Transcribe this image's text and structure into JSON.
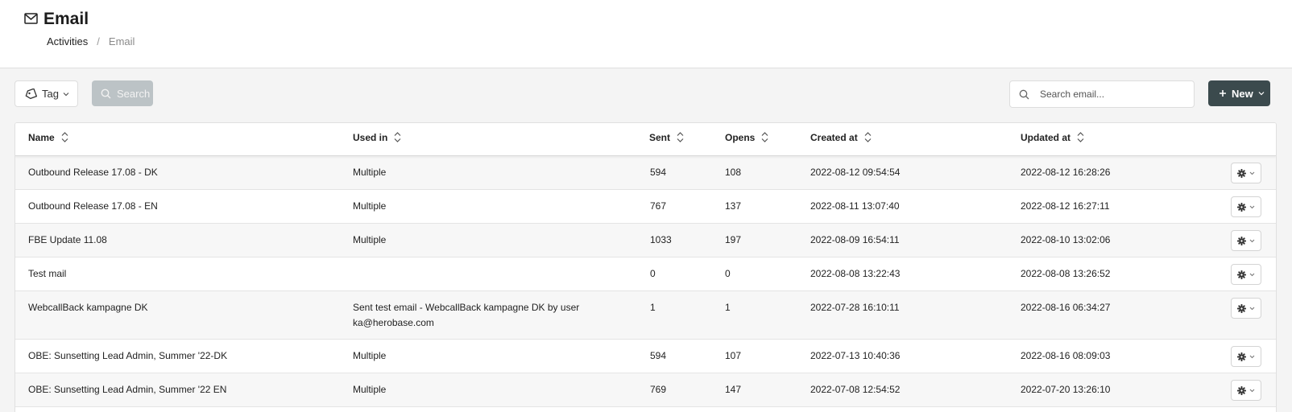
{
  "header": {
    "title": "Email",
    "icon": "mail-icon",
    "breadcrumb": {
      "parent": "Activities",
      "separator": "/",
      "current": "Email"
    }
  },
  "toolbar": {
    "tag_label": "Tag",
    "search_button_label": "Search",
    "search_placeholder": "Search email...",
    "new_label": "New"
  },
  "colors": {
    "primary_button": "#3b4a4d",
    "disabled_button": "#bcc3c6",
    "row_alt": "#f7f7f7"
  },
  "table": {
    "columns": [
      {
        "label": "Name"
      },
      {
        "label": "Used in"
      },
      {
        "label": "Sent"
      },
      {
        "label": "Opens"
      },
      {
        "label": "Created at"
      },
      {
        "label": "Updated at"
      }
    ],
    "rows": [
      {
        "name": "Outbound Release 17.08 - DK",
        "used_in": "Multiple",
        "sent": "594",
        "opens": "108",
        "created": "2022-08-12 09:54:54",
        "updated": "2022-08-12 16:28:26"
      },
      {
        "name": "Outbound Release 17.08 - EN",
        "used_in": "Multiple",
        "sent": "767",
        "opens": "137",
        "created": "2022-08-11 13:07:40",
        "updated": "2022-08-12 16:27:11"
      },
      {
        "name": "FBE Update 11.08",
        "used_in": "Multiple",
        "sent": "1033",
        "opens": "197",
        "created": "2022-08-09 16:54:11",
        "updated": "2022-08-10 13:02:06"
      },
      {
        "name": "Test mail",
        "used_in": "",
        "sent": "0",
        "opens": "0",
        "created": "2022-08-08 13:22:43",
        "updated": "2022-08-08 13:26:52"
      },
      {
        "name": "WebcallBack kampagne DK",
        "used_in": "Sent test email - WebcallBack kampagne DK by user ka@herobase.com",
        "sent": "1",
        "opens": "1",
        "created": "2022-07-28 16:10:11",
        "updated": "2022-08-16 06:34:27"
      },
      {
        "name": "OBE: Sunsetting Lead Admin, Summer '22-DK",
        "used_in": "Multiple",
        "sent": "594",
        "opens": "107",
        "created": "2022-07-13 10:40:36",
        "updated": "2022-08-16 08:09:03"
      },
      {
        "name": "OBE: Sunsetting Lead Admin, Summer '22 EN",
        "used_in": "Multiple",
        "sent": "769",
        "opens": "147",
        "created": "2022-07-08 12:54:52",
        "updated": "2022-07-20 13:26:10"
      }
    ]
  }
}
